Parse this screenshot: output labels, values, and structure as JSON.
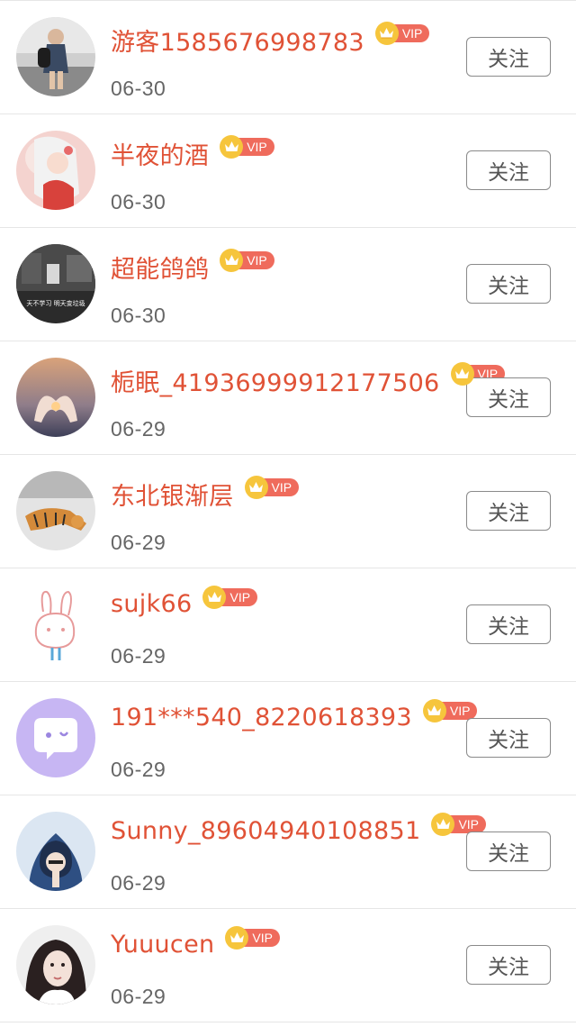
{
  "follow_label": "关注",
  "vip_label": "VIP",
  "users": [
    {
      "name": "游客1585676998783",
      "date": "06-30",
      "avatar": "girl-photo"
    },
    {
      "name": "半夜的酒",
      "date": "06-30",
      "avatar": "anime-girl"
    },
    {
      "name": "超能鸽鸽",
      "date": "06-30",
      "avatar": "video-still",
      "avatar_caption": "天不学习 明天变垃圾"
    },
    {
      "name": "栀眠_41936999912177506",
      "date": "06-29",
      "avatar": "heart-hands-sunset"
    },
    {
      "name": "东北银渐层",
      "date": "06-29",
      "avatar": "tiger-in-snow"
    },
    {
      "name": "sujk66",
      "date": "06-29",
      "avatar": "rabbit-doodle"
    },
    {
      "name": "191***540_8220618393",
      "date": "06-29",
      "avatar": "chat-bubble"
    },
    {
      "name": "Sunny_89604940108851",
      "date": "06-29",
      "avatar": "hooded-girl"
    },
    {
      "name": "Yuuucen",
      "date": "06-29",
      "avatar": "selfie-portrait"
    }
  ],
  "colors": {
    "name": "#e05236",
    "date": "#666666",
    "vip_tag": "#ef6b5c",
    "crown": "#f6c53c",
    "button_border": "#8a8a8a"
  }
}
